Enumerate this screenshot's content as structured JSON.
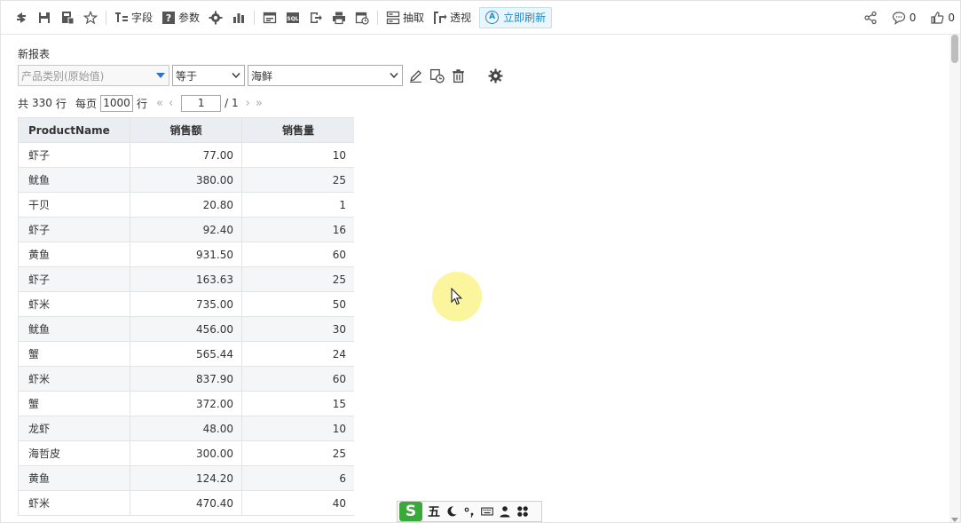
{
  "toolbar": {
    "field_label": "字段",
    "param_label": "参数",
    "extract_label": "抽取",
    "pivot_label": "透视",
    "refresh_now_label": "立即刷新",
    "refresh_icon_letter": "A",
    "comment_count": "0",
    "like_count": "0"
  },
  "report": {
    "title": "新报表"
  },
  "filter": {
    "field": "产品类别(原始值)",
    "operator": "等于",
    "value": "海鲜"
  },
  "pager": {
    "total_prefix": "共",
    "total": "330",
    "total_suffix": "行",
    "per_page_prefix": "每页",
    "page_size": "1000",
    "per_page_suffix": "行",
    "current_page": "1",
    "of_pages": "/ 1"
  },
  "table": {
    "columns": [
      "ProductName",
      "销售额",
      "销售量"
    ],
    "rows": [
      [
        "虾子",
        "77.00",
        "10"
      ],
      [
        "鱿鱼",
        "380.00",
        "25"
      ],
      [
        "干贝",
        "20.80",
        "1"
      ],
      [
        "虾子",
        "92.40",
        "16"
      ],
      [
        "黄鱼",
        "931.50",
        "60"
      ],
      [
        "虾子",
        "163.63",
        "25"
      ],
      [
        "虾米",
        "735.00",
        "50"
      ],
      [
        "鱿鱼",
        "456.00",
        "30"
      ],
      [
        "蟹",
        "565.44",
        "24"
      ],
      [
        "虾米",
        "837.90",
        "60"
      ],
      [
        "蟹",
        "372.00",
        "15"
      ],
      [
        "龙虾",
        "48.00",
        "10"
      ],
      [
        "海哲皮",
        "300.00",
        "25"
      ],
      [
        "黄鱼",
        "124.20",
        "6"
      ],
      [
        "虾米",
        "470.40",
        "40"
      ]
    ]
  },
  "ime": {
    "logo": "S",
    "mode": "五"
  },
  "colors": {
    "accent": "#1f8ac7",
    "header_bg": "#eaedf1",
    "alt_row_bg": "#f5f6f8",
    "cursor_highlight": "#faf58c",
    "ime_green": "#3aa83a"
  },
  "icons": [
    "refresh-icon",
    "save-icon",
    "save-as-icon",
    "star-icon",
    "field-icon",
    "param-icon",
    "gear-icon",
    "bar-chart-icon",
    "form-icon",
    "sql-icon",
    "export-icon",
    "print-icon",
    "schedule-icon",
    "extract-icon",
    "pivot-icon",
    "share-icon",
    "comment-icon",
    "like-icon",
    "edit-icon",
    "copy-icon",
    "trash-icon"
  ]
}
